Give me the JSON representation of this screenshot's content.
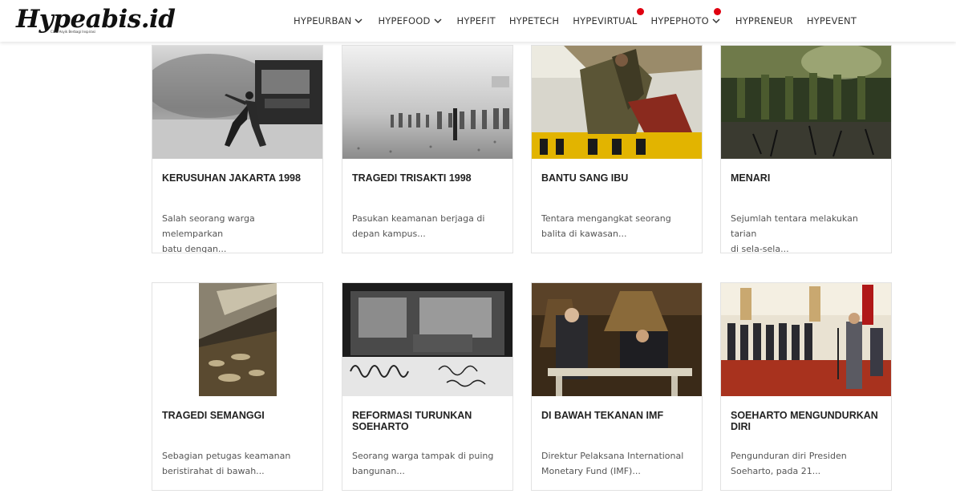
{
  "header": {
    "logo_text": "Hypeabis.id",
    "logo_tagline": "Cara Asyik Berbagi Inspirasi",
    "nav": [
      {
        "label": "HYPEURBAN",
        "has_dropdown": true,
        "notification": false
      },
      {
        "label": "HYPEFOOD",
        "has_dropdown": true,
        "notification": false
      },
      {
        "label": "HYPEFIT",
        "has_dropdown": false,
        "notification": false
      },
      {
        "label": "HYPETECH",
        "has_dropdown": false,
        "notification": false
      },
      {
        "label": "HYPEVIRTUAL",
        "has_dropdown": false,
        "notification": true
      },
      {
        "label": "HYPEPHOTO",
        "has_dropdown": true,
        "notification": true
      },
      {
        "label": "HYPRENEUR",
        "has_dropdown": false,
        "notification": false
      },
      {
        "label": "HYPEVENT",
        "has_dropdown": false,
        "notification": false
      }
    ]
  },
  "colors": {
    "notification_dot": "#e00010",
    "card_border": "#e2e2e2",
    "title": "#222222",
    "excerpt": "#555555"
  },
  "cards": [
    {
      "title": "KERUSUHAN JAKARTA 1998",
      "excerpt_lines": [
        "Salah seorang warga melemparkan",
        "batu dengan..."
      ],
      "image": "riot-burning-bus-bw"
    },
    {
      "title": "TRAGEDI TRISAKTI 1998",
      "excerpt_lines": [
        "Pasukan keamanan berjaga di",
        "depan kampus..."
      ],
      "image": "security-line-smoke-bw"
    },
    {
      "title": "BANTU SANG IBU",
      "excerpt_lines": [
        "Tentara mengangkat seorang",
        "balita di kawasan..."
      ],
      "image": "soldier-lifting-child-color"
    },
    {
      "title": "MENARI",
      "excerpt_lines": [
        "Sejumlah tentara melakukan tarian",
        "di sela-sela..."
      ],
      "image": "soldiers-dancing-color"
    },
    {
      "title": "TRAGEDI SEMANGGI",
      "excerpt_lines": [
        "Sebagian petugas keamanan",
        "beristirahat di bawah..."
      ],
      "image": "officers-resting-under-bridge"
    },
    {
      "title": "REFORMASI TURUNKAN SOEHARTO",
      "excerpt_lines": [
        "Seorang warga tampak di puing",
        "bangunan..."
      ],
      "image": "graffiti-ruins-bw"
    },
    {
      "title": "DI BAWAH TEKANAN IMF",
      "excerpt_lines": [
        "Direktur Pelaksana International",
        "Monetary Fund (IMF)..."
      ],
      "image": "imf-signing-color"
    },
    {
      "title": "SOEHARTO MENGUNDURKAN DIRI",
      "excerpt_lines": [
        "Pengunduran diri Presiden",
        "Soeharto, pada 21..."
      ],
      "image": "resignation-speech-color"
    }
  ]
}
